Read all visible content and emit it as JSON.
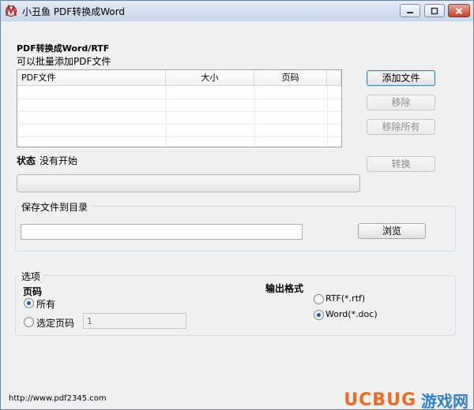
{
  "window": {
    "title": "小丑鱼 PDF转换成Word"
  },
  "files_section": {
    "heading": "PDF转换成Word/RTF",
    "subheading": "可以批量添加PDF文件",
    "columns": [
      "PDF文件",
      "大小",
      "页码"
    ],
    "rows": []
  },
  "buttons": {
    "add": "添加文件",
    "remove": "移除",
    "remove_all": "移除所有",
    "convert": "转换",
    "browse": "浏览"
  },
  "status": {
    "label": "状态",
    "value": "没有开始",
    "progress": 0
  },
  "save": {
    "group_label": "保存文件到目录",
    "path": ""
  },
  "options": {
    "group_label": "选项",
    "pages_heading": "页码",
    "all_label": "所有",
    "selected_label": "选定页码",
    "selected_pages_value": "1",
    "format_heading": "输出格式",
    "rtf_label": "RTF(*.rtf)",
    "word_label": "Word(*.doc)"
  },
  "statusbar": {
    "url": "http://www.pdf2345.com"
  },
  "watermark": {
    "brand_latin": "UCBUG",
    "brand_cn": "游戏网"
  },
  "colors": {
    "title_gradient_top": "#e3ebf6",
    "close_button": "#c7412b",
    "watermark_orange": "#f26a1b",
    "watermark_blue": "#2d7fd3"
  }
}
